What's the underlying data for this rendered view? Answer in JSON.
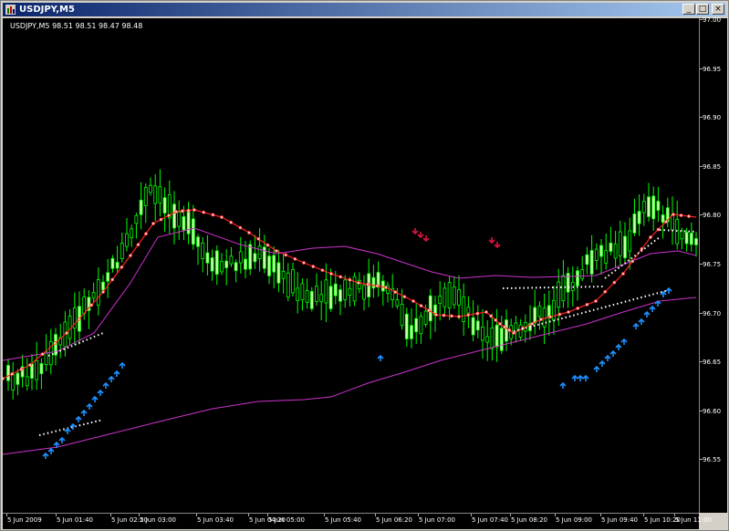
{
  "window": {
    "title": "USDJPY,M5",
    "buttons": {
      "minimize": "_",
      "maximize": "□",
      "close": "×"
    }
  },
  "chart": {
    "symbol_info": "USDJPY,M5  98.51 98.51 98.47 98.48",
    "price_labels": [
      "97.00",
      "96.95",
      "96.90",
      "96.85",
      "96.80",
      "96.75",
      "96.70",
      "96.65",
      "96.60",
      "96.55"
    ],
    "time_labels": [
      "5 Jun 2009",
      "5 Jun 01:40",
      "5 Jun 02:20",
      "5 Jun 03:00",
      "5 Jun 03:40",
      "5 Jun 04:20",
      "5 Jun 05:00",
      "5 Jun 05:40",
      "5 Jun 06:20",
      "5 Jun 07:00",
      "5 Jun 07:40",
      "5 Jun 08:20",
      "5 Jun 09:00",
      "5 Jun 09:40",
      "5 Jun 10:20",
      "5 Jun 11:00"
    ],
    "colors": {
      "background": "#000000",
      "bull_candle": "#ccffaa",
      "bear_candle": "#000000",
      "candle_wick": "#00ff00",
      "ma_line": "#ff2020",
      "envelope": "#cc33cc",
      "dots": "#ffffff",
      "buy_arrow": "#1e90ff",
      "sell_arrow": "#dc143c"
    }
  }
}
